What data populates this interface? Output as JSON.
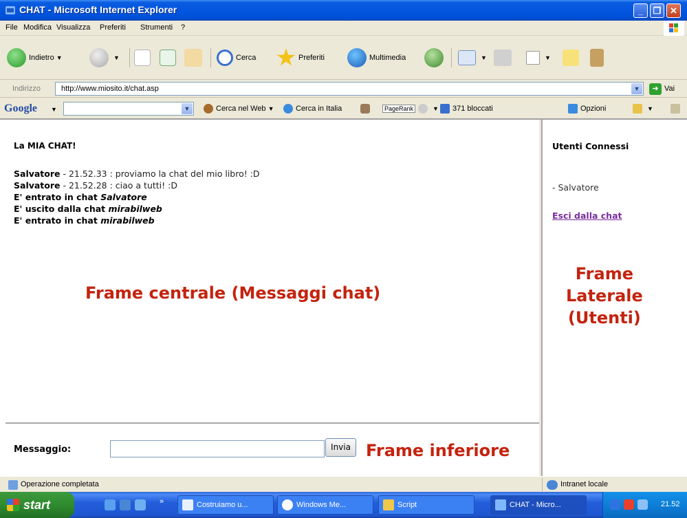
{
  "window": {
    "title": "CHAT - Microsoft Internet Explorer"
  },
  "menu": [
    "File",
    "Modifica",
    "Visualizza",
    "Preferiti",
    "Strumenti",
    "?"
  ],
  "toolbar": {
    "back": "Indietro",
    "search": "Cerca",
    "favorites": "Preferiti",
    "media": "Multimedia"
  },
  "address": {
    "label": "Indirizzo",
    "url": "http://www.miosito.it/chat.asp",
    "go": "Vai"
  },
  "google": {
    "logo": "Google",
    "search_web": "Cerca nel Web",
    "search_italy": "Cerca in Italia",
    "pagerank": "PageRank",
    "blocked": "371 bloccati",
    "options": "Opzioni"
  },
  "chat": {
    "title": "La MIA CHAT!",
    "messages": [
      {
        "user": "Salvatore",
        "text": " - 21.52.33 : proviamo la chat del mio libro! :D"
      },
      {
        "user": "Salvatore",
        "text": " - 21.52.28 : ciao a tutti! :D"
      }
    ],
    "events": [
      {
        "text": "E' entrato in chat ",
        "name": "Salvatore"
      },
      {
        "text": "E' uscito dalla chat ",
        "name": "mirabilweb"
      },
      {
        "text": "E' entrato in chat ",
        "name": "mirabilweb"
      }
    ],
    "frame_label": "Frame centrale (Messaggi chat)"
  },
  "side": {
    "title": "Utenti Connessi",
    "user": "- Salvatore",
    "exit_link": "Esci dalla chat",
    "frame_label_1": "Frame",
    "frame_label_2": "Laterale",
    "frame_label_3": "(Utenti)"
  },
  "bottom": {
    "label": "Messaggio:",
    "input_value": "",
    "send": "Invia",
    "frame_label": "Frame inferiore"
  },
  "status": {
    "text": "Operazione completata",
    "zone": "Intranet locale"
  },
  "taskbar": {
    "start": "start",
    "tasks": [
      "Costruiamo u...",
      "Windows Me...",
      "Script",
      "CHAT - Micro..."
    ],
    "clock": "21.52"
  }
}
